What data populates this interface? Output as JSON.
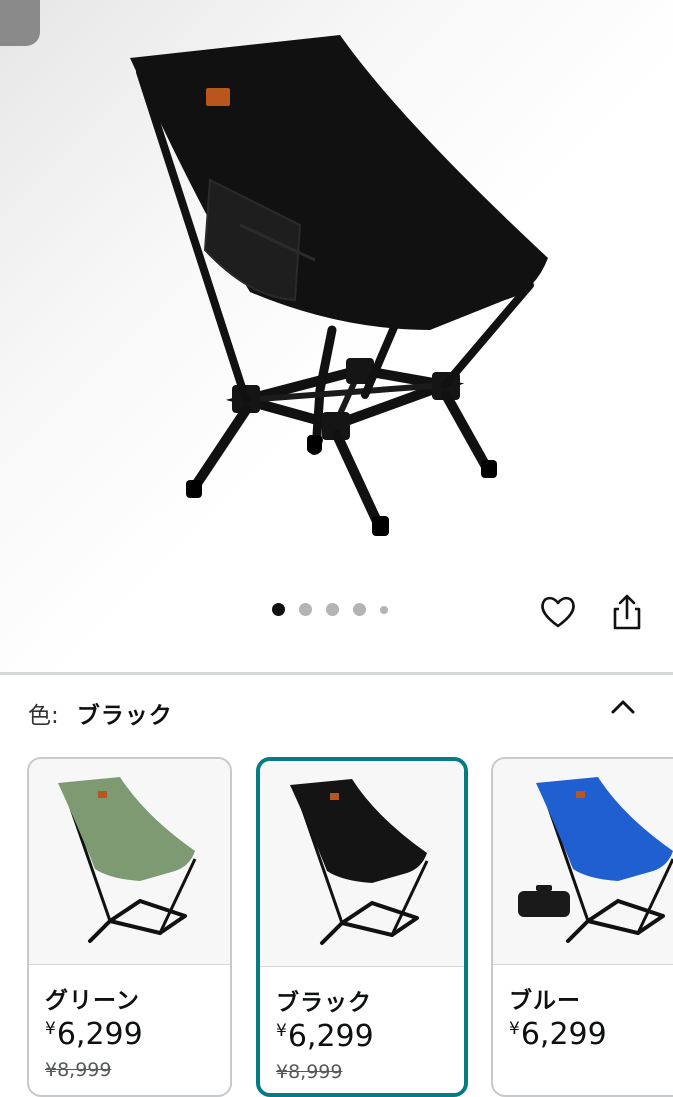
{
  "gallery": {
    "dot_count": 5,
    "active_dot": 0
  },
  "icons": {
    "favorite": "heart-outline-icon",
    "share": "share-icon",
    "collapse": "chevron-up-icon"
  },
  "variant": {
    "label": "色:",
    "selected": "ブラック"
  },
  "options": [
    {
      "name": "グリーン",
      "currency": "¥",
      "price": "6,299",
      "list_price": "¥8,999",
      "color": "#7d9a73"
    },
    {
      "name": "ブラック",
      "currency": "¥",
      "price": "6,299",
      "list_price": "¥8,999",
      "color": "#141414"
    },
    {
      "name": "ブルー",
      "currency": "¥",
      "price": "6,299",
      "color": "#1f5fd0"
    }
  ],
  "colors": {
    "selected_border": "#077b84",
    "divider": "#d5d9d9"
  }
}
